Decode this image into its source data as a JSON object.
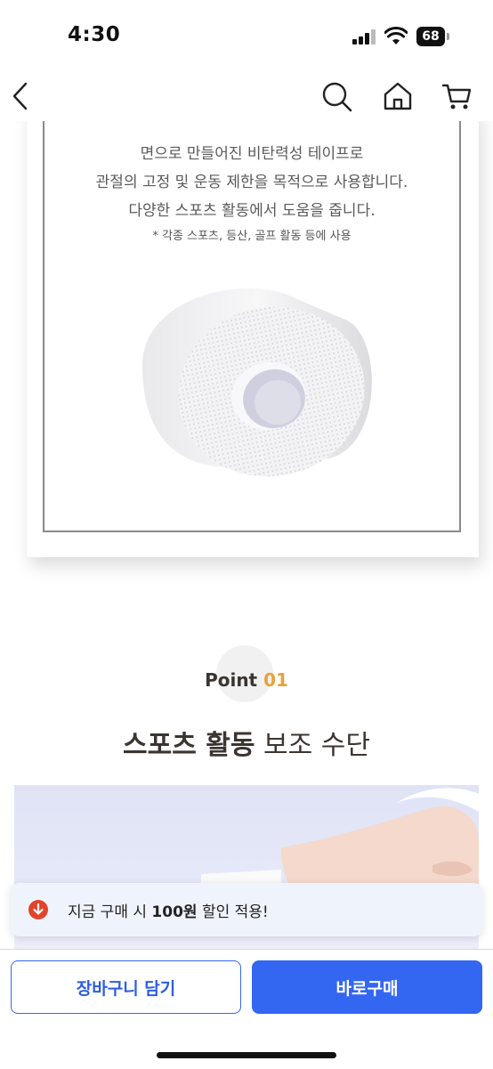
{
  "status_bar": {
    "time": "4:30",
    "battery": "68"
  },
  "product_desc": {
    "line1": "면으로 만들어진 비탄력성 테이프로",
    "line2": "관절의 고정 및 운동 제한을 목적으로 사용합니다.",
    "line3": "다양한 스포츠 활동에서 도움을 줍니다.",
    "note": "* 각종 스포츠, 등산, 골프 활동 등에 사용"
  },
  "point": {
    "label": "Point",
    "number": "01"
  },
  "headline": {
    "bold": "스포츠 활동",
    "regular": " 보조 수단"
  },
  "toast": {
    "prefix": "지금 구매 시 ",
    "amount": "100원",
    "suffix": " 할인 적용!"
  },
  "actions": {
    "cart_label": "장바구니 담기",
    "buy_label": "바로구매"
  },
  "colors": {
    "primary": "#3366f1",
    "point_accent": "#e8a23a",
    "toast_icon": "#e0452b"
  },
  "icons": [
    "back-icon",
    "search-icon",
    "home-icon",
    "cart-icon",
    "down-arrow-icon"
  ]
}
